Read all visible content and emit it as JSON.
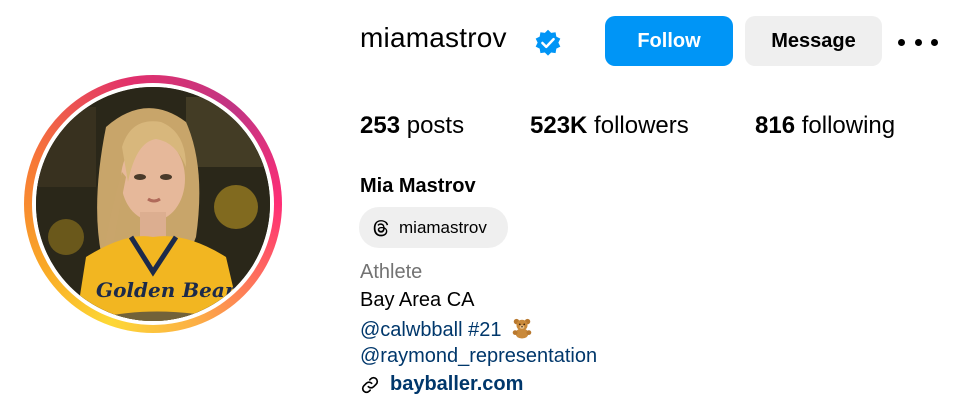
{
  "profile": {
    "username": "miamastrov",
    "verified_icon": "verified-badge-icon",
    "follow_label": "Follow",
    "message_label": "Message",
    "more_icon": "more-options-icon"
  },
  "stats": {
    "posts_count": "253",
    "posts_label": "posts",
    "followers_count": "523K",
    "followers_label": "followers",
    "following_count": "816",
    "following_label": "following"
  },
  "bio": {
    "full_name": "Mia Mastrov",
    "threads_handle": "miamastrov",
    "category": "Athlete",
    "location": "Bay Area CA",
    "mention_1": "@calwbball #21",
    "mention_1_emoji_icon": "teddy-bear-icon",
    "mention_2": "@raymond_representation",
    "link": "bayballer.com"
  },
  "colors": {
    "follow_button": "#0095f6",
    "secondary_button": "#efefef",
    "link_text": "#00376b",
    "category_text": "#737373"
  }
}
